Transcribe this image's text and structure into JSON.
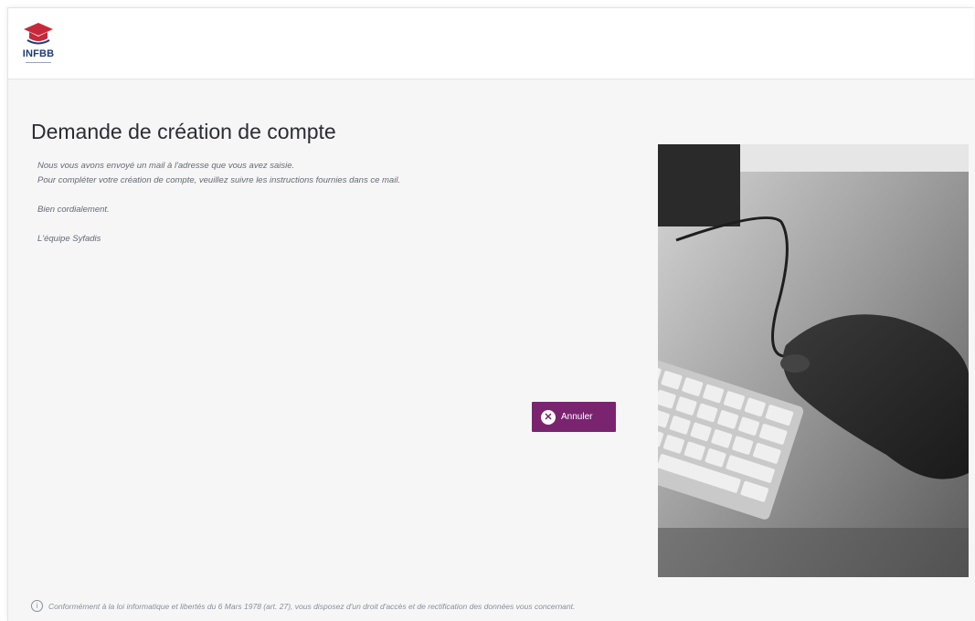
{
  "header": {
    "logo_text": "INFBB"
  },
  "page": {
    "title": "Demande de création de compte"
  },
  "message": {
    "line1": "Nous vous avons envoyé un mail à l'adresse que vous avez saisie.",
    "line2": "Pour compléter votre création de compte, veuillez suivre les instructions fournies dans ce mail.",
    "line3": "Bien cordialement.",
    "line4": "L'équipe Syfadis"
  },
  "actions": {
    "cancel_label": "Annuler",
    "cancel_icon": "close-circle-icon"
  },
  "footer": {
    "info_icon": "info-icon",
    "note": "Conformément à la loi informatique et libertés du 6 Mars 1978 (art. 27), vous disposez d'un droit d'accès et de rectification des données vous concernant."
  },
  "colors": {
    "brand_purple": "#7a2470",
    "logo_blue": "#1f3a7a",
    "logo_red": "#c8283a"
  }
}
